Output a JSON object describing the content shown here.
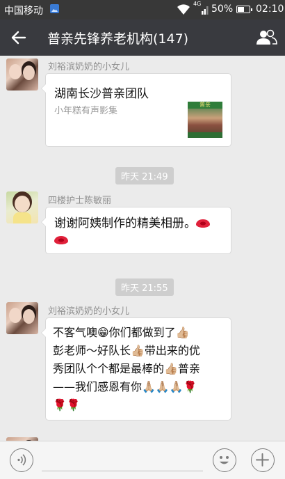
{
  "status_bar": {
    "carrier": "中国移动",
    "network_type": "4G",
    "battery_percent": "50%",
    "time": "02:10"
  },
  "header": {
    "title": "普亲先锋养老机构(147)",
    "back_icon": "arrow-left-icon",
    "members_icon": "people-icon"
  },
  "messages": [
    {
      "sender": "刘裕滨奶奶的小女儿",
      "avatar": "avatar-two-women",
      "type": "link",
      "title": "湖南长沙普亲团队",
      "description": "小年糕有声影集",
      "thumbnail_brand": "普亲"
    },
    {
      "type": "time",
      "text": "昨天 21:49"
    },
    {
      "sender": "四楼护士陈敏丽",
      "avatar": "avatar-woman-yellow",
      "type": "text",
      "text": "谢谢阿姨制作的精美相册。",
      "emoji": [
        "kiss-lips",
        "kiss-lips"
      ]
    },
    {
      "type": "time",
      "text": "昨天 21:55"
    },
    {
      "sender": "刘裕滨奶奶的小女儿",
      "avatar": "avatar-two-women",
      "type": "text",
      "lines": [
        "不客气噢😁你们都做到了👍🏼",
        "彭老师～好队长👍🏼带出来的优",
        "秀团队个个都是最棒的👍🏼普亲",
        "——我们感恩有你🙏🏼🙏🏼🙏🏼🌹",
        "🌹🌹"
      ]
    }
  ],
  "input_bar": {
    "voice_icon": "voice-icon",
    "emoji_icon": "emoji-icon",
    "plus_icon": "plus-icon"
  },
  "colors": {
    "header_bg": "#393a3f",
    "status_bg": "#383838",
    "chat_bg": "#ebebeb",
    "bubble_bg": "#ffffff",
    "time_pill_bg": "#cecece"
  }
}
